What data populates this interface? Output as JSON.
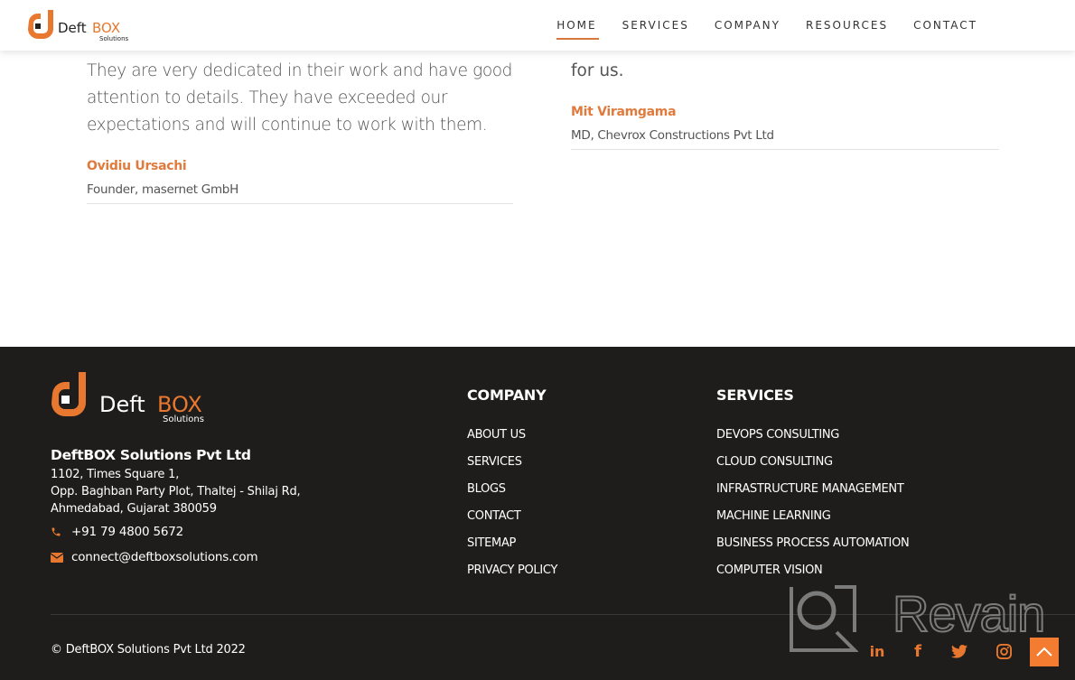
{
  "header": {
    "logo": {
      "word1": "Deft",
      "word2": "BOX",
      "sub": "Solutions"
    },
    "nav": [
      {
        "label": "HOME",
        "active": true
      },
      {
        "label": "SERVICES",
        "active": false
      },
      {
        "label": "COMPANY",
        "active": false
      },
      {
        "label": "RESOURCES",
        "active": false
      },
      {
        "label": "CONTACT",
        "active": false
      }
    ]
  },
  "testimonials": [
    {
      "quote": "They are very dedicated in their work and have good attention to details. They have exceeded our expectations and will continue to work with them.",
      "author": "Ovidiu Ursachi",
      "role": "Founder, masernet GmbH"
    },
    {
      "quote_tail": "for us.",
      "author": "Mit Viramgama",
      "role": "MD, Chevrox Constructions Pvt Ltd"
    }
  ],
  "footer": {
    "logo": {
      "word1": "Deft",
      "word2": "BOX",
      "sub": "Solutions"
    },
    "company_name": "DeftBOX Solutions Pvt Ltd",
    "address": [
      "1102, Times Square 1,",
      "Opp. Baghban Party Plot, Thaltej - Shilaj Rd,",
      "Ahmedabad, Gujarat 380059"
    ],
    "phone": {
      "icon": "phone-icon",
      "value": "+91 79 4800 5672"
    },
    "email": {
      "icon": "envelope-icon",
      "value": "connect@deftboxsolutions.com"
    },
    "company_col": {
      "title": "COMPANY",
      "links": [
        "ABOUT US",
        "SERVICES",
        "BLOGS",
        "CONTACT",
        "SITEMAP",
        "PRIVACY POLICY"
      ]
    },
    "services_col": {
      "title": "SERVICES",
      "links": [
        "DEVOPS CONSULTING",
        "CLOUD CONSULTING",
        "INFRASTRUCTURE MANAGEMENT",
        "MACHINE LEARNING",
        "BUSINESS PROCESS AUTOMATION",
        "COMPUTER VISION"
      ]
    },
    "copyright": "© DeftBOX Solutions Pvt Ltd 2022",
    "social": [
      {
        "name": "linkedin-icon",
        "glyph": "in"
      },
      {
        "name": "facebook-icon",
        "glyph": "f"
      },
      {
        "name": "twitter-icon",
        "glyph": ""
      },
      {
        "name": "instagram-icon",
        "glyph": ""
      }
    ],
    "back_to_top_icon": "chevron-up-icon"
  },
  "watermark": {
    "text": "Revain"
  },
  "colors": {
    "accent": "#e8782f",
    "footer_bg": "#1e1d1b",
    "text": "#555555"
  }
}
